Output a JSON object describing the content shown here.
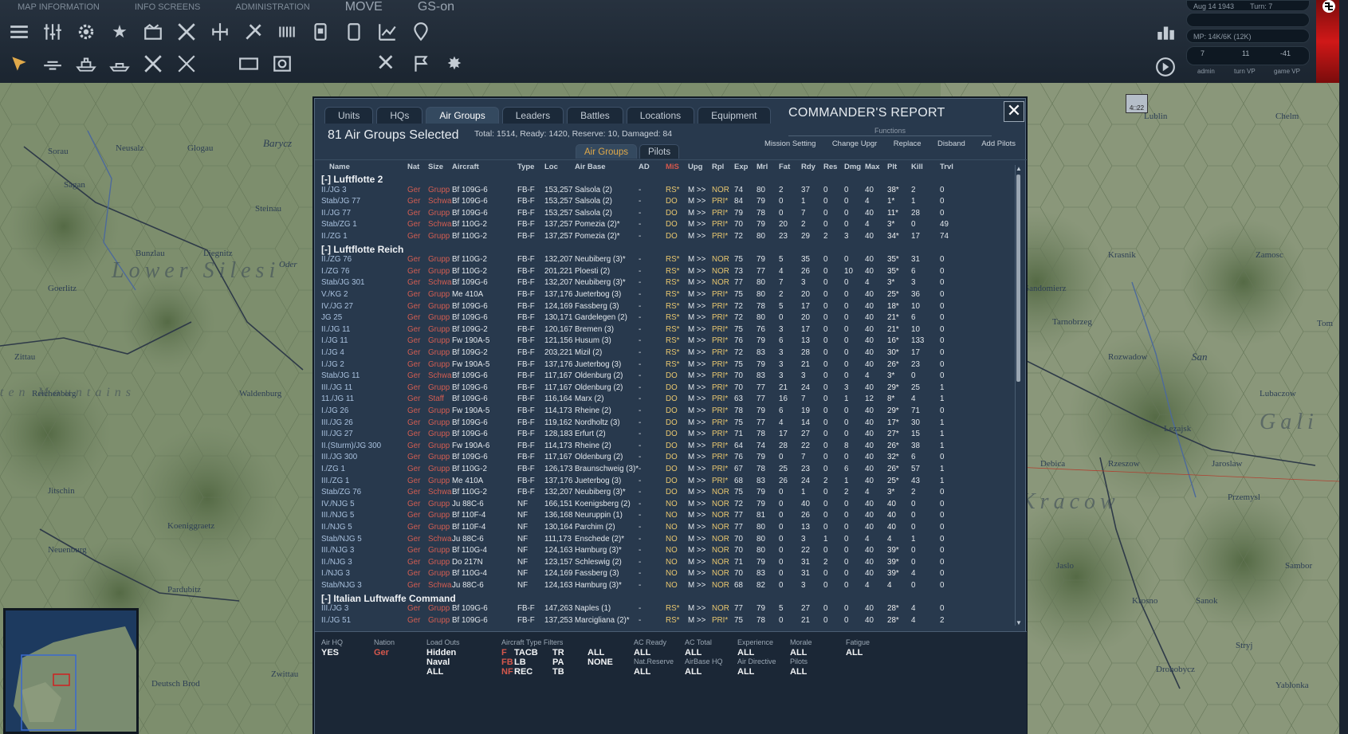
{
  "menu": {
    "items": [
      "MAP INFORMATION",
      "INFO SCREENS",
      "ADMINISTRATION"
    ],
    "move": "MOVE",
    "gs": "GS-on"
  },
  "status": {
    "date": "Aug 14 1943",
    "turn": "Turn: 7",
    "mp": "MP: 14K/6K (12K)",
    "admin_val": "7",
    "turn_vp_val": "11",
    "game_vp_val": "-41",
    "admin_lbl": "admin",
    "turn_vp_lbl": "turn VP",
    "game_vp_lbl": "game VP"
  },
  "map": {
    "big_labels": [
      "Lower Silesi",
      "Gali",
      "Kracow",
      "ten Mountains"
    ],
    "towns": [
      "Sorau",
      "Neusalz",
      "Glogau",
      "Sagan",
      "Barycz",
      "Steinau",
      "Bunzlau",
      "Liegnitz",
      "Oder",
      "Goerlitz",
      "Zittau",
      "Reichenberg",
      "Waldenburg",
      "Jitschin",
      "Koeniggraetz",
      "Pardubitz",
      "Neuenburg",
      "Deutsch Brod",
      "Zwittau",
      "Lublin",
      "Chelm",
      "Krasnik",
      "Zamosc",
      "Sandomierz",
      "Tarnobrzeg",
      "Rozwadow",
      "San",
      "Lubaczow",
      "Lezajsk",
      "Debica",
      "Rzeszow",
      "Jaroslaw",
      "Przemysl",
      "Jaslo",
      "Krosno",
      "Sambor",
      "Sanok",
      "Stryj",
      "Drohobycz",
      "Yablonka",
      "Tom"
    ],
    "unit_counter": "4□22"
  },
  "panel": {
    "tabs": [
      "Units",
      "HQs",
      "Air Groups",
      "Leaders",
      "Battles",
      "Locations",
      "Equipment"
    ],
    "active_tab": "Air Groups",
    "title": "COMMANDER'S REPORT",
    "close": "✕",
    "selected": "81 Air Groups Selected",
    "totals": "Total: 1514, Ready: 1420, Reserve: 10, Damaged: 84",
    "functions_title": "Functions",
    "functions": [
      "Mission Setting",
      "Change Upgr",
      "Replace",
      "Disband",
      "Add Pilots"
    ],
    "subtabs": [
      "Air Groups",
      "Pilots"
    ],
    "columns": [
      "Name",
      "Nat",
      "Size",
      "Aircraft",
      "Type",
      "Loc",
      "Air Base",
      "AD",
      "MiS",
      "Upg",
      "Rpl",
      "Exp",
      "Mrl",
      "Fat",
      "Rdy",
      "Res",
      "Dmg",
      "Max",
      "Plt",
      "Kill",
      "Trvl"
    ]
  },
  "groups": [
    {
      "name": "[-]  Luftflotte 2",
      "rows": [
        [
          "II./JG 3",
          "Ger",
          "Grupp",
          "Bf 109G-6",
          "FB-F",
          "153,257",
          "Salsola (2)",
          "-",
          "RS*",
          "M >>",
          "NOR",
          "74",
          "80",
          "2",
          "37",
          "0",
          "0",
          "40",
          "38*",
          "2",
          "0"
        ],
        [
          "Stab/JG 77",
          "Ger",
          "Schwa",
          "Bf 109G-6",
          "FB-F",
          "153,257",
          "Salsola (2)",
          "-",
          "DO",
          "M >>",
          "PRI*",
          "84",
          "79",
          "0",
          "1",
          "0",
          "0",
          "4",
          "1*",
          "1",
          "0"
        ],
        [
          "II./JG 77",
          "Ger",
          "Grupp",
          "Bf 109G-6",
          "FB-F",
          "153,257",
          "Salsola (2)",
          "-",
          "DO",
          "M >>",
          "PRI*",
          "79",
          "78",
          "0",
          "7",
          "0",
          "0",
          "40",
          "11*",
          "28",
          "0"
        ],
        [
          "Stab/ZG 1",
          "Ger",
          "Schwa",
          "Bf 110G-2",
          "FB-F",
          "137,257",
          "Pomezia (2)*",
          "-",
          "DO",
          "M >>",
          "PRI*",
          "70",
          "79",
          "20",
          "2",
          "0",
          "0",
          "4",
          "3*",
          "0",
          "49"
        ],
        [
          "II./ZG 1",
          "Ger",
          "Grupp",
          "Bf 110G-2",
          "FB-F",
          "137,257",
          "Pomezia (2)*",
          "-",
          "DO",
          "M >>",
          "PRI*",
          "72",
          "80",
          "23",
          "29",
          "2",
          "3",
          "40",
          "34*",
          "17",
          "74"
        ]
      ]
    },
    {
      "name": "[-]  Luftflotte Reich",
      "rows": [
        [
          "II./ZG 76",
          "Ger",
          "Grupp",
          "Bf 110G-2",
          "FB-F",
          "132,207",
          "Neubiberg (3)*",
          "-",
          "RS*",
          "M >>",
          "NOR",
          "75",
          "79",
          "5",
          "35",
          "0",
          "0",
          "40",
          "35*",
          "31",
          "0"
        ],
        [
          "I./ZG 76",
          "Ger",
          "Grupp",
          "Bf 110G-2",
          "FB-F",
          "201,221",
          "Ploesti (2)",
          "-",
          "RS*",
          "M >>",
          "NOR",
          "73",
          "77",
          "4",
          "26",
          "0",
          "10",
          "40",
          "35*",
          "6",
          "0"
        ],
        [
          "Stab/JG 301",
          "Ger",
          "Schwa",
          "Bf 109G-6",
          "FB-F",
          "132,207",
          "Neubiberg (3)*",
          "-",
          "RS*",
          "M >>",
          "NOR",
          "77",
          "80",
          "7",
          "3",
          "0",
          "0",
          "4",
          "3*",
          "3",
          "0"
        ],
        [
          "V./KG 2",
          "Ger",
          "Grupp",
          "Me 410A",
          "FB-F",
          "137,176",
          "Jueterbog (3)",
          "-",
          "RS*",
          "M >>",
          "PRI*",
          "75",
          "80",
          "2",
          "20",
          "0",
          "0",
          "40",
          "25*",
          "36",
          "0"
        ],
        [
          "IV./JG 27",
          "Ger",
          "Grupp",
          "Bf 109G-6",
          "FB-F",
          "124,169",
          "Fassberg (3)",
          "-",
          "RS*",
          "M >>",
          "PRI*",
          "72",
          "78",
          "5",
          "17",
          "0",
          "0",
          "40",
          "18*",
          "10",
          "0"
        ],
        [
          "JG 25",
          "Ger",
          "Grupp",
          "Bf 109G-6",
          "FB-F",
          "130,171",
          "Gardelegen (2)",
          "-",
          "RS*",
          "M >>",
          "PRI*",
          "72",
          "80",
          "0",
          "20",
          "0",
          "0",
          "40",
          "21*",
          "6",
          "0"
        ],
        [
          "II./JG 11",
          "Ger",
          "Grupp",
          "Bf 109G-2",
          "FB-F",
          "120,167",
          "Bremen (3)",
          "-",
          "RS*",
          "M >>",
          "PRI*",
          "75",
          "76",
          "3",
          "17",
          "0",
          "0",
          "40",
          "21*",
          "10",
          "0"
        ],
        [
          "I./JG 11",
          "Ger",
          "Grupp",
          "Fw 190A-5",
          "FB-F",
          "121,156",
          "Husum (3)",
          "-",
          "RS*",
          "M >>",
          "PRI*",
          "76",
          "79",
          "6",
          "13",
          "0",
          "0",
          "40",
          "16*",
          "133",
          "0"
        ],
        [
          "I./JG 4",
          "Ger",
          "Grupp",
          "Bf 109G-2",
          "FB-F",
          "203,221",
          "Mizil (2)",
          "-",
          "RS*",
          "M >>",
          "PRI*",
          "72",
          "83",
          "3",
          "28",
          "0",
          "0",
          "40",
          "30*",
          "17",
          "0"
        ],
        [
          "I./JG 2",
          "Ger",
          "Grupp",
          "Fw 190A-5",
          "FB-F",
          "137,176",
          "Jueterbog (3)",
          "-",
          "RS*",
          "M >>",
          "PRI*",
          "75",
          "79",
          "3",
          "21",
          "0",
          "0",
          "40",
          "26*",
          "23",
          "0"
        ],
        [
          "Stab/JG 11",
          "Ger",
          "Schwa",
          "Bf 109G-6",
          "FB-F",
          "117,167",
          "Oldenburg (2)",
          "-",
          "DO",
          "M >>",
          "PRI*",
          "70",
          "83",
          "3",
          "3",
          "0",
          "0",
          "4",
          "3*",
          "0",
          "0"
        ],
        [
          "III./JG 11",
          "Ger",
          "Grupp",
          "Bf 109G-6",
          "FB-F",
          "117,167",
          "Oldenburg (2)",
          "-",
          "DO",
          "M >>",
          "PRI*",
          "70",
          "77",
          "21",
          "24",
          "0",
          "3",
          "40",
          "29*",
          "25",
          "1"
        ],
        [
          "11./JG 11",
          "Ger",
          "Staff",
          "Bf 109G-6",
          "FB-F",
          "116,164",
          "Marx (2)",
          "-",
          "DO",
          "M >>",
          "PRI*",
          "63",
          "77",
          "16",
          "7",
          "0",
          "1",
          "12",
          "8*",
          "4",
          "1"
        ],
        [
          "I./JG 26",
          "Ger",
          "Grupp",
          "Fw 190A-5",
          "FB-F",
          "114,173",
          "Rheine (2)",
          "-",
          "DO",
          "M >>",
          "PRI*",
          "78",
          "79",
          "6",
          "19",
          "0",
          "0",
          "40",
          "29*",
          "71",
          "0"
        ],
        [
          "III./JG 26",
          "Ger",
          "Grupp",
          "Bf 109G-6",
          "FB-F",
          "119,162",
          "Nordholtz (3)",
          "-",
          "DO",
          "M >>",
          "PRI*",
          "75",
          "77",
          "4",
          "14",
          "0",
          "0",
          "40",
          "17*",
          "30",
          "1"
        ],
        [
          "III./JG 27",
          "Ger",
          "Grupp",
          "Bf 109G-6",
          "FB-F",
          "128,183",
          "Erfurt (2)",
          "-",
          "DO",
          "M >>",
          "PRI*",
          "71",
          "78",
          "17",
          "27",
          "0",
          "0",
          "40",
          "27*",
          "15",
          "1"
        ],
        [
          "II.(Sturm)/JG 300",
          "Ger",
          "Grupp",
          "Fw 190A-6",
          "FB-F",
          "114,173",
          "Rheine (2)",
          "-",
          "DO",
          "M >>",
          "PRI*",
          "64",
          "74",
          "28",
          "22",
          "0",
          "8",
          "40",
          "26*",
          "38",
          "1"
        ],
        [
          "III./JG 300",
          "Ger",
          "Grupp",
          "Bf 109G-6",
          "FB-F",
          "117,167",
          "Oldenburg (2)",
          "-",
          "DO",
          "M >>",
          "PRI*",
          "76",
          "79",
          "0",
          "7",
          "0",
          "0",
          "40",
          "32*",
          "6",
          "0"
        ],
        [
          "I./ZG 1",
          "Ger",
          "Grupp",
          "Bf 110G-2",
          "FB-F",
          "126,173",
          "Braunschweig (3)*",
          "-",
          "DO",
          "M >>",
          "PRI*",
          "67",
          "78",
          "25",
          "23",
          "0",
          "6",
          "40",
          "26*",
          "57",
          "1"
        ],
        [
          "III./ZG 1",
          "Ger",
          "Grupp",
          "Me 410A",
          "FB-F",
          "137,176",
          "Jueterbog (3)",
          "-",
          "DO",
          "M >>",
          "PRI*",
          "68",
          "83",
          "26",
          "24",
          "2",
          "1",
          "40",
          "25*",
          "43",
          "1"
        ],
        [
          "Stab/ZG 76",
          "Ger",
          "Schwa",
          "Bf 110G-2",
          "FB-F",
          "132,207",
          "Neubiberg (3)*",
          "-",
          "DO",
          "M >>",
          "NOR",
          "75",
          "79",
          "0",
          "1",
          "0",
          "2",
          "4",
          "3*",
          "2",
          "0"
        ],
        [
          "IV./NJG 5",
          "Ger",
          "Grupp",
          "Ju 88C-6",
          "NF",
          "166,151",
          "Koenigsberg (2)",
          "-",
          "NO",
          "M >>",
          "NOR",
          "72",
          "79",
          "0",
          "40",
          "0",
          "0",
          "40",
          "40",
          "0",
          "0"
        ],
        [
          "III./NJG 5",
          "Ger",
          "Grupp",
          "Bf 110F-4",
          "NF",
          "136,168",
          "Neuruppin (1)",
          "-",
          "NO",
          "M >>",
          "NOR",
          "77",
          "81",
          "0",
          "26",
          "0",
          "0",
          "40",
          "40",
          "0",
          "0"
        ],
        [
          "II./NJG 5",
          "Ger",
          "Grupp",
          "Bf 110F-4",
          "NF",
          "130,164",
          "Parchim (2)",
          "-",
          "NO",
          "M >>",
          "NOR",
          "77",
          "80",
          "0",
          "13",
          "0",
          "0",
          "40",
          "40",
          "0",
          "0"
        ],
        [
          "Stab/NJG 5",
          "Ger",
          "Schwa",
          "Ju 88C-6",
          "NF",
          "111,173",
          "Enschede (2)*",
          "-",
          "NO",
          "M >>",
          "NOR",
          "70",
          "80",
          "0",
          "3",
          "1",
          "0",
          "4",
          "4",
          "1",
          "0"
        ],
        [
          "III./NJG 3",
          "Ger",
          "Grupp",
          "Bf 110G-4",
          "NF",
          "124,163",
          "Hamburg (3)*",
          "-",
          "NO",
          "M >>",
          "NOR",
          "70",
          "80",
          "0",
          "22",
          "0",
          "0",
          "40",
          "39*",
          "0",
          "0"
        ],
        [
          "II./NJG 3",
          "Ger",
          "Grupp",
          "Do 217N",
          "NF",
          "123,157",
          "Schleswig (2)",
          "-",
          "NO",
          "M >>",
          "NOR",
          "71",
          "79",
          "0",
          "31",
          "2",
          "0",
          "40",
          "39*",
          "0",
          "0"
        ],
        [
          "I./NJG 3",
          "Ger",
          "Grupp",
          "Bf 110G-4",
          "NF",
          "124,169",
          "Fassberg (3)",
          "-",
          "NO",
          "M >>",
          "NOR",
          "70",
          "83",
          "0",
          "31",
          "0",
          "0",
          "40",
          "39*",
          "4",
          "0"
        ],
        [
          "Stab/NJG 3",
          "Ger",
          "Schwa",
          "Ju 88C-6",
          "NF",
          "124,163",
          "Hamburg (3)*",
          "-",
          "NO",
          "M >>",
          "NOR",
          "68",
          "82",
          "0",
          "3",
          "0",
          "0",
          "4",
          "4",
          "0",
          "0"
        ]
      ]
    },
    {
      "name": "[-]  Italian Luftwaffe Command",
      "rows": [
        [
          "III./JG 3",
          "Ger",
          "Grupp",
          "Bf 109G-6",
          "FB-F",
          "147,263",
          "Naples (1)",
          "-",
          "RS*",
          "M >>",
          "NOR",
          "77",
          "79",
          "5",
          "27",
          "0",
          "0",
          "40",
          "28*",
          "4",
          "0"
        ],
        [
          "II./JG 51",
          "Ger",
          "Grupp",
          "Bf 109G-6",
          "FB-F",
          "137,253",
          "Marcigliana (2)*",
          "-",
          "RS*",
          "M >>",
          "PRI*",
          "75",
          "78",
          "0",
          "21",
          "0",
          "0",
          "40",
          "28*",
          "4",
          "2"
        ]
      ]
    }
  ],
  "filters": [
    {
      "label": "Air HQ",
      "values": [
        "YES"
      ]
    },
    {
      "label": "Nation",
      "values": [
        "Ger"
      ],
      "red": true
    },
    {
      "label": "Load Outs",
      "values": [
        "Hidden",
        "Naval",
        "ALL"
      ]
    },
    {
      "label": "Aircraft  Type  Filters",
      "values": []
    },
    {
      "label": "AC Ready",
      "values": [
        "ALL",
        "Nat.Reserve",
        "ALL"
      ]
    },
    {
      "label": "AC Total",
      "values": [
        "ALL",
        "AirBase HQ",
        "ALL"
      ]
    },
    {
      "label": "Experience",
      "values": [
        "ALL",
        "Air Directive",
        "ALL"
      ]
    },
    {
      "label": "Morale",
      "values": [
        "ALL",
        "Pilots",
        "ALL"
      ]
    },
    {
      "label": "Fatigue",
      "values": [
        "ALL"
      ]
    }
  ],
  "type_filters": {
    "col1": [
      "F",
      "FB",
      "NF"
    ],
    "col2": [
      "TACB",
      "LB",
      "REC"
    ],
    "col3": [
      "TR",
      "PA",
      "TB"
    ],
    "col4": [
      "ALL",
      "NONE"
    ]
  },
  "colors": {
    "accent": "#e0a94a",
    "red": "#d4574c",
    "name_blue": "#a9c1de",
    "panel": "#28394d"
  }
}
